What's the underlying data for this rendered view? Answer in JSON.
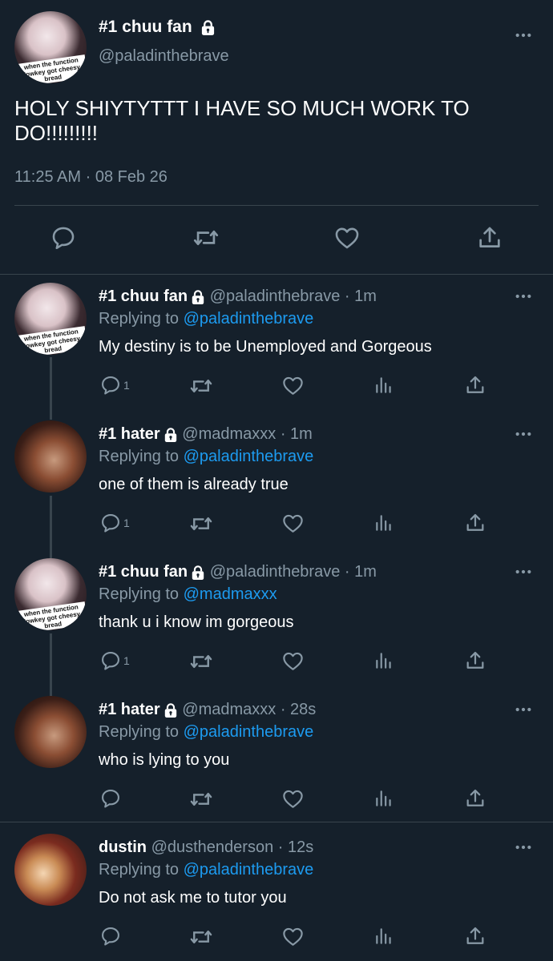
{
  "main_tweet": {
    "display_name": "#1 chuu fan",
    "handle": "@paladinthebrave",
    "avatar_caption": [
      "when the function",
      "lowkey got cheesy",
      "bread"
    ],
    "text_line1": "HOLY SHIYTYTTT I HAVE SO MUCH WORK TO",
    "text_line2": "DO!!!!!!!!!",
    "time": "11:25 AM",
    "separator": "·",
    "date": "08 Feb 26"
  },
  "replies": [
    {
      "display_name": "#1 chuu fan",
      "handle": "@paladinthebrave",
      "time": "· 1m",
      "replying_label": "Replying to",
      "replying_to": "@paladinthebrave",
      "text": "My destiny is to be Unemployed and Gorgeous",
      "reply_count": "1",
      "avatar_caption": [
        "when the function",
        "lowkey got cheesy",
        "bread"
      ]
    },
    {
      "display_name": "#1 hater",
      "handle": "@madmaxxx",
      "time": "· 1m",
      "replying_label": "Replying to",
      "replying_to": "@paladinthebrave",
      "text": "one of them is already true",
      "reply_count": "1"
    },
    {
      "display_name": "#1 chuu fan",
      "handle": "@paladinthebrave",
      "time": "· 1m",
      "replying_label": "Replying to",
      "replying_to": "@madmaxxx",
      "text": "thank u i know im gorgeous",
      "reply_count": "1",
      "avatar_caption": [
        "when the function",
        "lowkey got cheesy",
        "bread"
      ]
    },
    {
      "display_name": "#1 hater",
      "handle": "@madmaxxx",
      "time": "· 28s",
      "replying_label": "Replying to",
      "replying_to": "@paladinthebrave",
      "text": "who is lying to you",
      "reply_count": ""
    },
    {
      "display_name": "dustin",
      "handle": "@dusthenderson",
      "time": "· 12s",
      "replying_label": "Replying to",
      "replying_to": "@paladinthebrave",
      "text": "Do not ask me to tutor you",
      "reply_count": ""
    }
  ],
  "icons": {
    "more": "more-dots-icon",
    "lock": "lock-icon",
    "reply": "reply-icon",
    "retweet": "retweet-icon",
    "like": "heart-icon",
    "views": "analytics-icon",
    "share": "share-icon"
  },
  "colors": {
    "background": "#15202b",
    "muted": "#8899a6",
    "link": "#1d9bf0",
    "divider": "#38444d"
  }
}
